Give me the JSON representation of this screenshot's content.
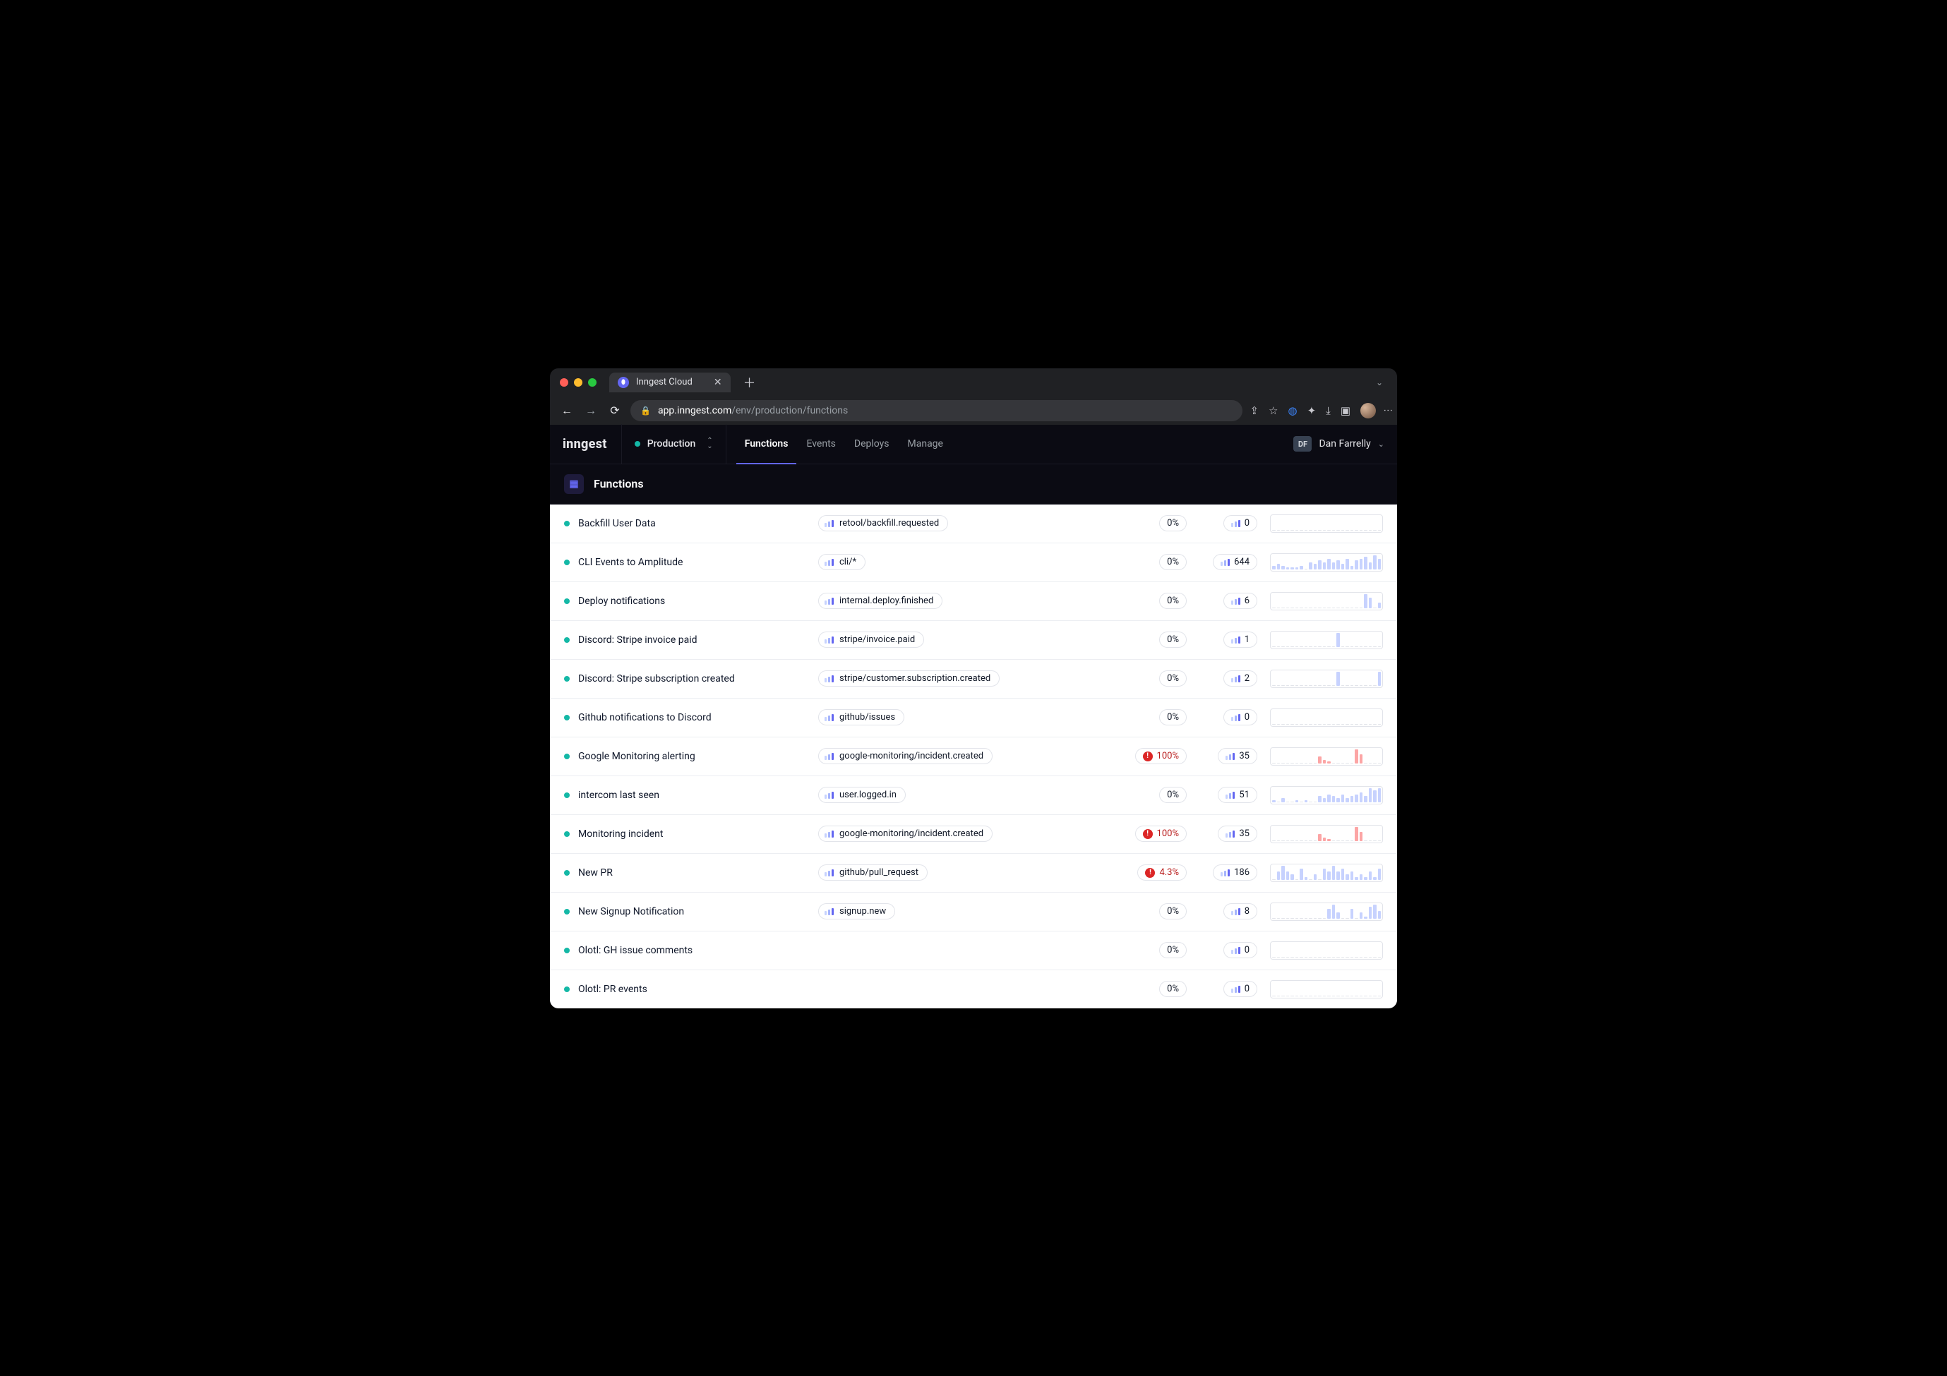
{
  "browser": {
    "tab_title": "Inngest Cloud",
    "address": {
      "domain": "app.inngest.com",
      "path": "/env/production/functions"
    }
  },
  "header": {
    "logo": "inngest",
    "env": "Production",
    "nav": [
      "Functions",
      "Events",
      "Deploys",
      "Manage"
    ],
    "user_initials": "DF",
    "user_name": "Dan Farrelly"
  },
  "page_title": "Functions",
  "functions": [
    {
      "name": "Backfill User Data",
      "event": "retool/backfill.requested",
      "failure": "0%",
      "failure_error": false,
      "count": 0,
      "spark": [
        0,
        0,
        0,
        0,
        0,
        0,
        0,
        0,
        0,
        0,
        0,
        0,
        0,
        0,
        0,
        0,
        0,
        0,
        0,
        0,
        0,
        0,
        0,
        0
      ],
      "spark_error": false
    },
    {
      "name": "CLI Events to Amplitude",
      "event": "cli/*",
      "failure": "0%",
      "failure_error": false,
      "count": 644,
      "spark": [
        2,
        3,
        2,
        1,
        1,
        1,
        2,
        0,
        4,
        3,
        5,
        4,
        6,
        4,
        5,
        3,
        6,
        2,
        5,
        6,
        7,
        4,
        8,
        6
      ],
      "spark_error": false
    },
    {
      "name": "Deploy notifications",
      "event": "internal.deploy.finished",
      "failure": "0%",
      "failure_error": false,
      "count": 6,
      "spark": [
        0,
        0,
        0,
        0,
        0,
        0,
        0,
        0,
        0,
        0,
        0,
        0,
        0,
        0,
        0,
        0,
        0,
        0,
        0,
        0,
        8,
        6,
        0,
        3
      ],
      "spark_error": false
    },
    {
      "name": "Discord: Stripe invoice paid",
      "event": "stripe/invoice.paid",
      "failure": "0%",
      "failure_error": false,
      "count": 1,
      "spark": [
        0,
        0,
        0,
        0,
        0,
        0,
        0,
        0,
        0,
        0,
        0,
        0,
        0,
        0,
        7,
        0,
        0,
        0,
        0,
        0,
        0,
        0,
        0,
        0
      ],
      "spark_error": false
    },
    {
      "name": "Discord: Stripe subscription created",
      "event": "stripe/customer.subscription.created",
      "failure": "0%",
      "failure_error": false,
      "count": 2,
      "spark": [
        0,
        0,
        0,
        0,
        0,
        0,
        0,
        0,
        0,
        0,
        0,
        0,
        0,
        0,
        6,
        0,
        0,
        0,
        0,
        0,
        0,
        0,
        0,
        6
      ],
      "spark_error": false
    },
    {
      "name": "Github notifications to Discord",
      "event": "github/issues",
      "failure": "0%",
      "failure_error": false,
      "count": 0,
      "spark": [
        0,
        0,
        0,
        0,
        0,
        0,
        0,
        0,
        0,
        0,
        0,
        0,
        0,
        0,
        0,
        0,
        0,
        0,
        0,
        0,
        0,
        0,
        0,
        0
      ],
      "spark_error": false
    },
    {
      "name": "Google Monitoring alerting",
      "event": "google-monitoring/incident.created",
      "failure": "100%",
      "failure_error": true,
      "count": 35,
      "spark": [
        0,
        0,
        0,
        0,
        0,
        0,
        0,
        0,
        0,
        0,
        4,
        2,
        1,
        0,
        0,
        0,
        0,
        0,
        8,
        5,
        0,
        0,
        0,
        0
      ],
      "spark_error": true
    },
    {
      "name": "intercom last seen",
      "event": "user.logged.in",
      "failure": "0%",
      "failure_error": false,
      "count": 51,
      "spark": [
        1,
        0,
        2,
        0,
        0,
        1,
        0,
        1,
        0,
        0,
        3,
        2,
        4,
        3,
        2,
        4,
        2,
        3,
        4,
        5,
        3,
        7,
        6,
        7
      ],
      "spark_error": false
    },
    {
      "name": "Monitoring incident",
      "event": "google-monitoring/incident.created",
      "failure": "100%",
      "failure_error": true,
      "count": 35,
      "spark": [
        0,
        0,
        0,
        0,
        0,
        0,
        0,
        0,
        0,
        0,
        4,
        2,
        1,
        0,
        0,
        0,
        0,
        0,
        8,
        5,
        0,
        0,
        0,
        0
      ],
      "spark_error": true
    },
    {
      "name": "New PR",
      "event": "github/pull_request",
      "failure": "4.3%",
      "failure_error": true,
      "count": 186,
      "spark": [
        0,
        3,
        5,
        3,
        2,
        0,
        4,
        1,
        0,
        2,
        0,
        4,
        3,
        5,
        3,
        4,
        2,
        3,
        1,
        2,
        1,
        3,
        1,
        4
      ],
      "spark_error": false
    },
    {
      "name": "New Signup Notification",
      "event": "signup.new",
      "failure": "0%",
      "failure_error": false,
      "count": 8,
      "spark": [
        0,
        0,
        0,
        0,
        0,
        0,
        0,
        0,
        0,
        0,
        0,
        0,
        5,
        7,
        3,
        0,
        0,
        5,
        0,
        3,
        1,
        6,
        7,
        4
      ],
      "spark_error": false
    },
    {
      "name": "Olotl: GH issue comments",
      "event": "",
      "failure": "0%",
      "failure_error": false,
      "count": 0,
      "spark": [
        0,
        0,
        0,
        0,
        0,
        0,
        0,
        0,
        0,
        0,
        0,
        0,
        0,
        0,
        0,
        0,
        0,
        0,
        0,
        0,
        0,
        0,
        0,
        0
      ],
      "spark_error": false
    },
    {
      "name": "Olotl: PR events",
      "event": "",
      "failure": "0%",
      "failure_error": false,
      "count": 0,
      "spark": [
        0,
        0,
        0,
        0,
        0,
        0,
        0,
        0,
        0,
        0,
        0,
        0,
        0,
        0,
        0,
        0,
        0,
        0,
        0,
        0,
        0,
        0,
        0,
        0
      ],
      "spark_error": false
    }
  ]
}
